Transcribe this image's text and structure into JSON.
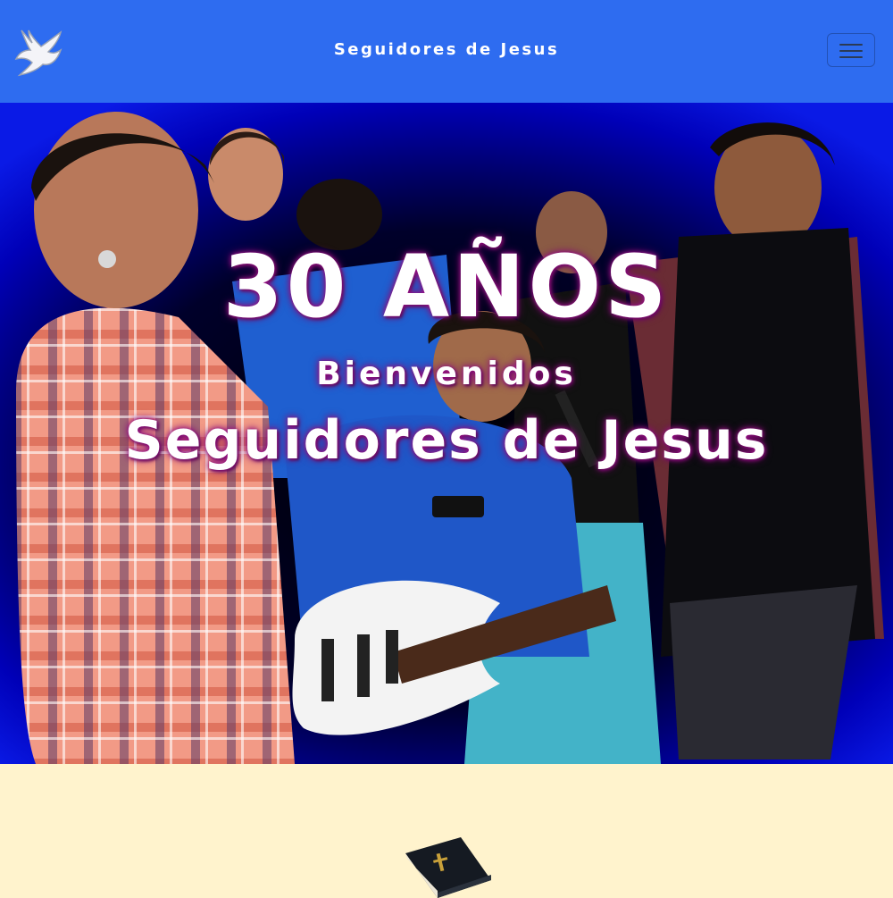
{
  "navbar": {
    "brand_title": "Seguidores de Jesus",
    "logo_icon": "dove-icon",
    "menu_icon": "hamburger-menu-icon",
    "background_color": "#2e6cf0"
  },
  "hero": {
    "headline": "30 AÑOS",
    "subtitle": "Bienvenidos",
    "title": "Seguidores de Jesus",
    "text_glow_color": "#a0148c",
    "image_description_icon": "worship-band-photo"
  },
  "section2": {
    "background_color": "#fff3cd",
    "icon": "bible-icon"
  }
}
